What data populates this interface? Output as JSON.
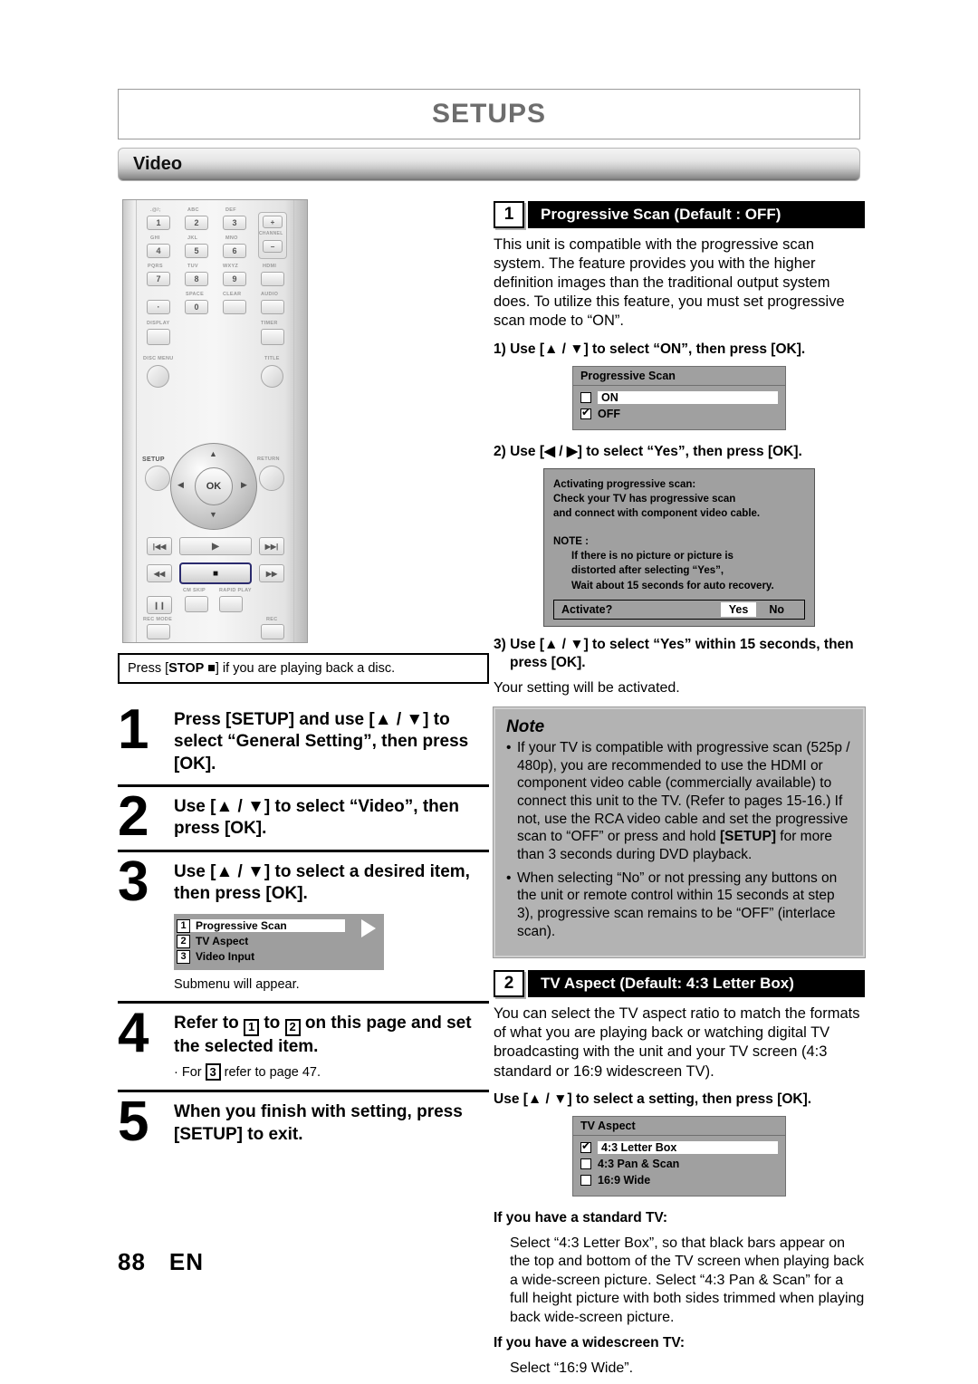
{
  "header": {
    "title": "SETUPS",
    "section": "Video"
  },
  "remote": {
    "keys": [
      {
        "label": ".@/;",
        "key": "1"
      },
      {
        "label": "ABC",
        "key": "2"
      },
      {
        "label": "DEF",
        "key": "3"
      },
      {
        "label": "GHI",
        "key": "4"
      },
      {
        "label": "JKL",
        "key": "5"
      },
      {
        "label": "MNO",
        "key": "6"
      },
      {
        "label": "PQRS",
        "key": "7"
      },
      {
        "label": "TUV",
        "key": "8"
      },
      {
        "label": "WXYZ",
        "key": "9"
      },
      {
        "label": "",
        "key": "·"
      },
      {
        "label": "SPACE",
        "key": "0"
      }
    ],
    "channel_label": "CHANNEL",
    "channel_plus": "+",
    "channel_minus": "−",
    "hdmi": "HDMI",
    "clear": "CLEAR",
    "audio": "AUDIO",
    "display": "DISPLAY",
    "timer": "TIMER",
    "disc_menu": "DISC MENU",
    "title_btn": "TITLE",
    "setup": "SETUP",
    "return_btn": "RETURN",
    "ok": "OK",
    "cm_skip": "CM SKIP",
    "rapid_play": "RAPID PLAY",
    "rec_mode": "REC MODE",
    "rec": "REC",
    "transport": {
      "prev": "|◀◀",
      "play": "▶",
      "next": "▶▶|",
      "rew": "◀◀",
      "stop": "■",
      "ffwd": "▶▶",
      "pause": "❙❙"
    }
  },
  "left": {
    "callout": "Press [STOP ■] if you are playing back a disc.",
    "callout_parts": {
      "pre": "Press [",
      "bold": "STOP ■",
      "post": "] if you are playing back a disc."
    },
    "steps": [
      {
        "num": "1",
        "head": "Press [SETUP] and use [▲ / ▼] to select “General Setting”, then press [OK]."
      },
      {
        "num": "2",
        "head": "Use [▲ / ▼] to select “Video”, then press [OK]."
      },
      {
        "num": "3",
        "head": "Use [▲ / ▼] to select a desired item, then press [OK].",
        "sub": "Submenu will appear.",
        "submenu": [
          {
            "num": "1",
            "label": "Progressive Scan",
            "selected": true
          },
          {
            "num": "2",
            "label": "TV Aspect",
            "selected": false
          },
          {
            "num": "3",
            "label": "Video Input",
            "selected": false
          }
        ]
      },
      {
        "num": "4",
        "head": "Refer to  1  to  2  on this page and set the selected item.",
        "head_parts": {
          "a": "Refer to",
          "k1": "1",
          "b": "to",
          "k2": "2",
          "c": "on this page and set the selected item."
        },
        "bullet": {
          "pre": "· For",
          "key": "3",
          "post": "refer to page 47."
        }
      },
      {
        "num": "5",
        "head": "When you finish with setting, press [SETUP] to exit."
      }
    ],
    "page_number": "88",
    "page_lang": "EN"
  },
  "right": {
    "section1": {
      "badge": "1",
      "title": "Progressive Scan (Default : OFF)",
      "paragraph": "This unit is compatible with the progressive scan system. The feature provides you with the higher definition images than the traditional output system does. To utilize this feature, you must set progressive scan mode to “ON”.",
      "step1_label": "1) Use [▲ / ▼] to select “ON”, then press [OK].",
      "dialog1": {
        "title": "Progressive Scan",
        "items": [
          {
            "label": "ON",
            "checked": false,
            "highlighted": true
          },
          {
            "label": "OFF",
            "checked": true,
            "highlighted": false
          }
        ]
      },
      "step2_label": "2) Use [◀ / ▶] to select “Yes”, then press [OK].",
      "dialog2": {
        "lines": [
          "Activating progressive scan:",
          "Check your TV has progressive scan",
          "and connect with component video cable."
        ],
        "note_label": "NOTE :",
        "note_lines": [
          "If there is no picture or picture is",
          "distorted after selecting    “Yes”,",
          "Wait about 15 seconds for auto recovery."
        ],
        "action_question": "Activate?",
        "action_yes": "Yes",
        "action_no": "No"
      },
      "step3_label": "3) Use [▲ / ▼] to select “Yes” within 15 seconds, then",
      "step3_label2": "press [OK].",
      "step3_sub": "Your setting will be activated."
    },
    "note": {
      "heading": "Note",
      "items": [
        {
          "pre": "If your TV is compatible with progressive scan (525p / 480p), you are recommended to use the HDMI or component video cable (commercially available) to connect this unit to the TV. (Refer to pages 15-16.) If not, use the RCA video cable and set the progressive scan to “OFF” or press and hold ",
          "bold": "[SETUP]",
          "post": " for more than 3 seconds during DVD playback."
        },
        {
          "pre": "When selecting “No” or not pressing any buttons on the unit or remote control within 15 seconds at step 3), progressive scan remains to be “OFF” (interlace scan).",
          "bold": "",
          "post": ""
        }
      ]
    },
    "section2": {
      "badge": "2",
      "title": "TV Aspect (Default: 4:3 Letter Box)",
      "paragraph": "You can select the TV aspect ratio to match the formats of what you are playing back or watching digital TV broadcasting with the unit and your TV screen (4:3 standard or 16:9 widescreen TV).",
      "instruction": "Use [▲ / ▼] to select a setting, then press [OK].",
      "dialog": {
        "title": "TV Aspect",
        "items": [
          {
            "label": "4:3 Letter Box",
            "checked": true,
            "highlighted": true
          },
          {
            "label": "4:3 Pan & Scan",
            "checked": false,
            "highlighted": false
          },
          {
            "label": "16:9 Wide",
            "checked": false,
            "highlighted": false
          }
        ]
      },
      "standard_tv_heading": "If you have a standard TV:",
      "standard_tv_text": "Select “4:3 Letter Box”, so that black bars appear on the top and bottom of the TV screen when playing back a wide-screen picture. Select “4:3 Pan & Scan” for a full height picture with both sides trimmed when playing back wide-screen picture.",
      "widescreen_tv_heading": "If you have a widescreen TV:",
      "widescreen_tv_text": "Select “16:9 Wide”."
    }
  }
}
